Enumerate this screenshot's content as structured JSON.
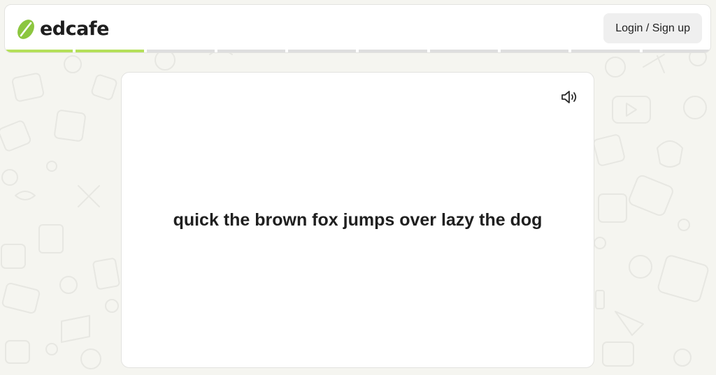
{
  "header": {
    "logo_text": "edcafe",
    "login_label": "Login / Sign up",
    "progress": {
      "total_segments": 10,
      "completed_segments": 2
    }
  },
  "card": {
    "sentence": "quick the brown fox jumps over lazy the dog",
    "audio_icon": "speaker-icon"
  },
  "colors": {
    "accent": "#b5e05a",
    "logo_green": "#8cc63f",
    "background": "#f5f5f0",
    "progress_empty": "#dedede"
  }
}
